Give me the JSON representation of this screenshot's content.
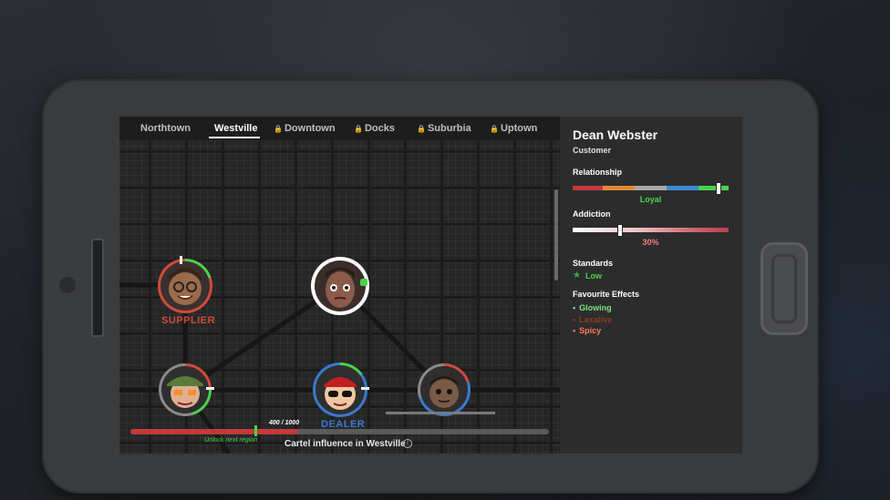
{
  "tabs": [
    {
      "label": "Northtown",
      "locked": false,
      "active": false
    },
    {
      "label": "Westville",
      "locked": false,
      "active": true
    },
    {
      "label": "Downtown",
      "locked": true,
      "active": false
    },
    {
      "label": "Docks",
      "locked": true,
      "active": false
    },
    {
      "label": "Suburbia",
      "locked": true,
      "active": false
    },
    {
      "label": "Uptown",
      "locked": true,
      "active": false
    }
  ],
  "lock_glyph": "🔒",
  "nodes": {
    "supplier_label": "SUPPLIER",
    "dealer_label": "DEALER"
  },
  "influence": {
    "count": "400 / 1000",
    "unlock_text": "Unlock next region",
    "label": "Cartel influence in Westville",
    "info_glyph": "i",
    "progress_fraction": 0.4
  },
  "panel": {
    "name": "Dean Webster",
    "role": "Customer",
    "relationship_heading": "Relationship",
    "relationship_value": "Loyal",
    "relationship_fraction": 0.93,
    "addiction_heading": "Addiction",
    "addiction_value": "30%",
    "addiction_fraction": 0.3,
    "standards_heading": "Standards",
    "standards_icon": "star-icon",
    "standards_value": "Low",
    "effects_heading": "Favourite Effects",
    "effects": [
      {
        "label": "Glowing",
        "color": "#7ee07e"
      },
      {
        "label": "Laxative",
        "color": "#8a3a2a"
      },
      {
        "label": "Spicy",
        "color": "#ff7a5a"
      }
    ]
  },
  "colors": {
    "supplier": "#d04a3a",
    "dealer": "#3a7ad0",
    "loyal": "#4ad14a"
  }
}
